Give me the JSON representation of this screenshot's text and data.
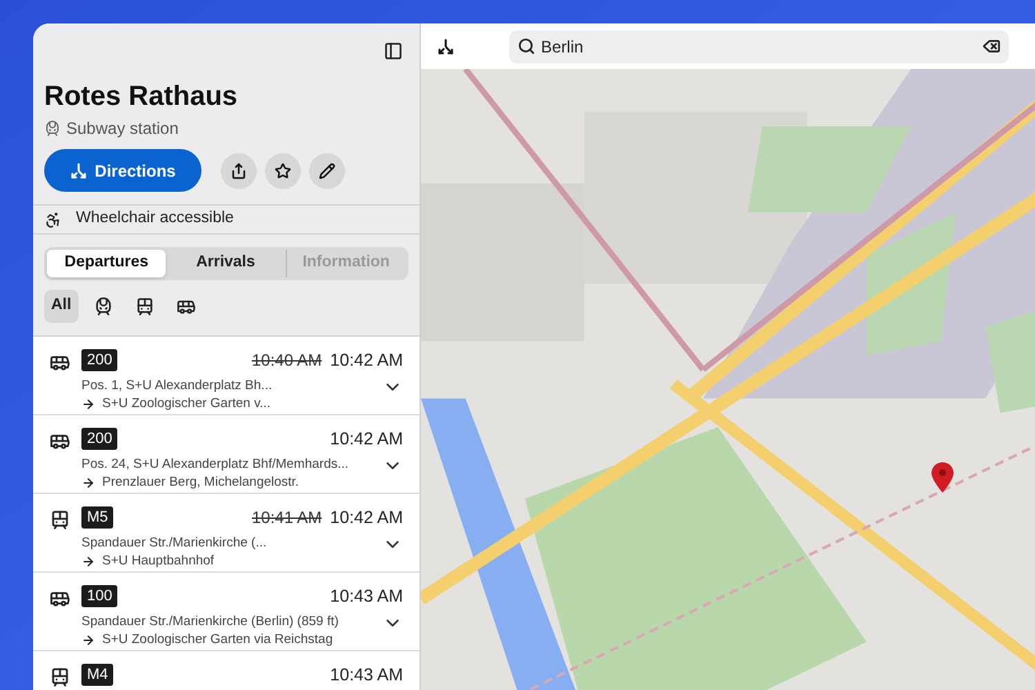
{
  "sidebar": {
    "title": "Rotes Rathaus",
    "subtitle": "Subway station",
    "directions_button": "Directions",
    "accessibility": "Wheelchair accessible",
    "tabs": [
      {
        "label": "Departures",
        "selected": true,
        "disabled": false
      },
      {
        "label": "Arrivals",
        "selected": false,
        "disabled": false
      },
      {
        "label": "Information",
        "selected": false,
        "disabled": true
      }
    ],
    "filters": [
      {
        "kind": "all",
        "label": "All",
        "selected": true
      },
      {
        "kind": "subway",
        "selected": false
      },
      {
        "kind": "tram",
        "selected": false
      },
      {
        "kind": "bus",
        "selected": false
      }
    ],
    "departures": [
      {
        "kind": "bus",
        "line": "200",
        "scheduled": "10:40 AM",
        "time": "10:42 AM",
        "stop": "Pos. 1, S+U Alexanderplatz Bh...",
        "destination": "S+U Zoologischer Garten v..."
      },
      {
        "kind": "bus",
        "line": "200",
        "time": "10:42 AM",
        "stop": "Pos. 24, S+U Alexanderplatz Bhf/Memhards...",
        "destination": "Prenzlauer Berg, Michelangelostr."
      },
      {
        "kind": "tram",
        "line": "M5",
        "scheduled": "10:41 AM",
        "time": "10:42 AM",
        "stop": "Spandauer Str./Marienkirche (...",
        "destination": "S+U Hauptbahnhof"
      },
      {
        "kind": "bus",
        "line": "100",
        "time": "10:43 AM",
        "stop": "Spandauer Str./Marienkirche (Berlin) (859 ft)",
        "destination": "S+U Zoologischer Garten via Reichstag"
      },
      {
        "kind": "tram",
        "line": "M4",
        "time": "10:43 AM"
      }
    ]
  },
  "search": {
    "value": "Berlin"
  }
}
